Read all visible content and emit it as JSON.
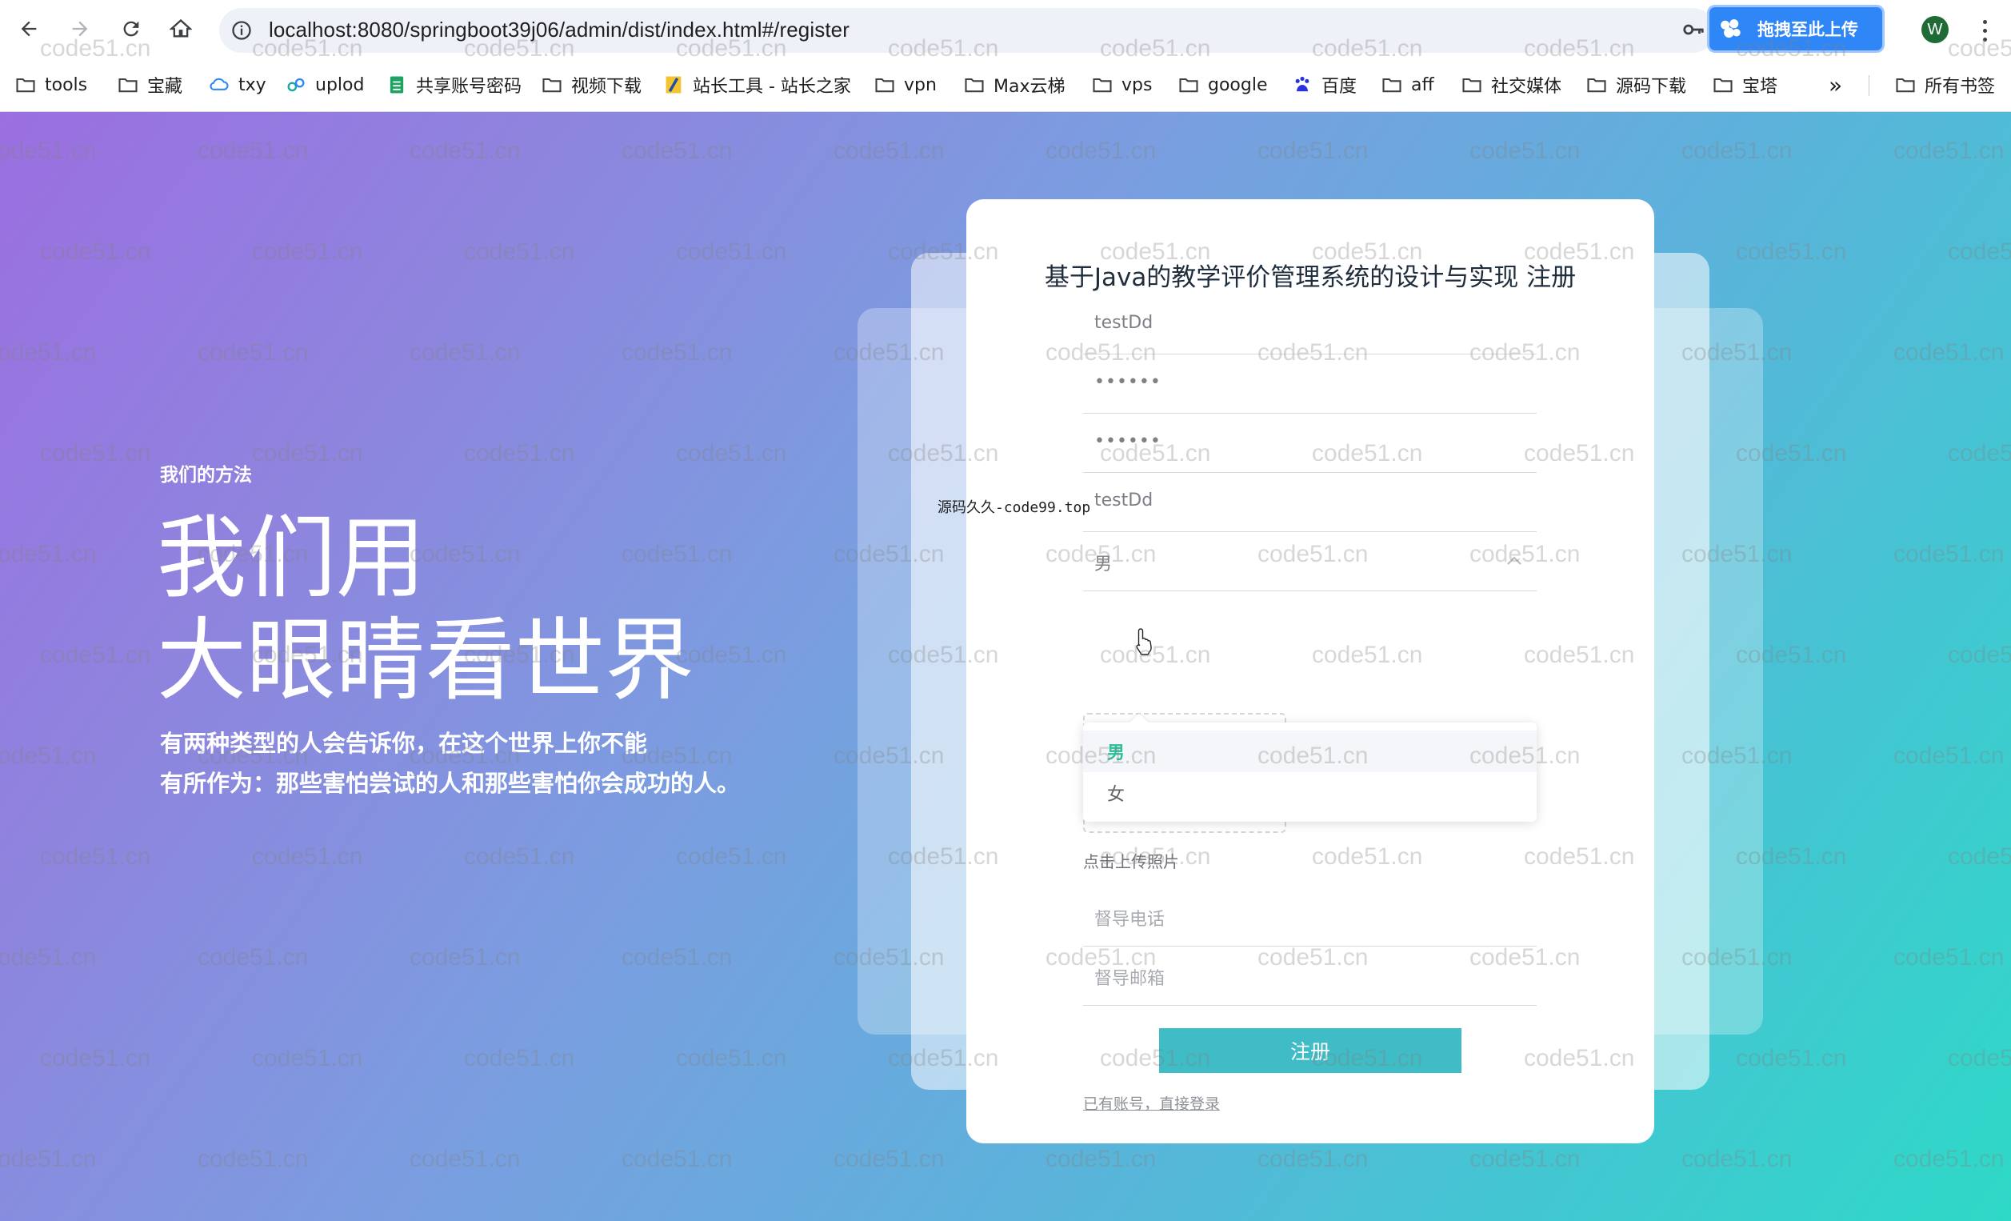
{
  "browser": {
    "url": "localhost:8080/springboot39j06/admin/dist/index.html#/register",
    "extension_label": "拖拽至此上传",
    "profile_initial": "W",
    "bookmarks": [
      {
        "label": "tools",
        "icon": "folder-icon"
      },
      {
        "label": "宝藏",
        "icon": "folder-icon"
      },
      {
        "label": "txy",
        "icon": "cloud-icon"
      },
      {
        "label": "uplod",
        "icon": "link-icon"
      },
      {
        "label": "共享账号密码",
        "icon": "sheet-icon"
      },
      {
        "label": "视频下载",
        "icon": "folder-icon"
      },
      {
        "label": "站长工具 - 站长之家",
        "icon": "site-icon"
      },
      {
        "label": "vpn",
        "icon": "folder-icon"
      },
      {
        "label": "Max云梯",
        "icon": "folder-icon"
      },
      {
        "label": "vps",
        "icon": "folder-icon"
      },
      {
        "label": "google",
        "icon": "folder-icon"
      },
      {
        "label": "百度",
        "icon": "baidu-icon"
      },
      {
        "label": "aff",
        "icon": "folder-icon"
      },
      {
        "label": "社交媒体",
        "icon": "folder-icon"
      },
      {
        "label": "源码下载",
        "icon": "folder-icon"
      },
      {
        "label": "宝塔",
        "icon": "folder-icon"
      }
    ],
    "more_label": "»",
    "all_bookmarks": "所有书签"
  },
  "hero": {
    "kicker": "我们的方法",
    "title_line1": "我们用",
    "title_line2": "大眼睛看世界",
    "desc_line1": "有两种类型的人会告诉你，在这个世界上你不能",
    "desc_line2": "有所作为：那些害怕尝试的人和那些害怕你会成功的人。"
  },
  "form": {
    "title": "基于Java的教学评价管理系统的设计与实现 注册",
    "account": "testDd",
    "password": "••••••",
    "confirm_password": "••••••",
    "name": "testDd",
    "gender": "男",
    "gender_options": [
      "男",
      "女"
    ],
    "upload_label": "点击上传照片",
    "phone_placeholder": "督导电话",
    "email_placeholder": "督导邮箱",
    "submit": "注册",
    "login_link": "已有账号，直接登录"
  },
  "overlay_tag": "源码久久-code99.top",
  "watermark": "code51.cn"
}
